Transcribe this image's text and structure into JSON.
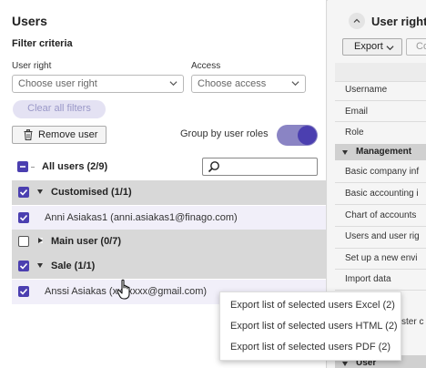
{
  "users_panel": {
    "title": "Users",
    "filter_title": "Filter criteria",
    "user_right_label": "User right",
    "user_right_placeholder": "Choose user right",
    "access_label": "Access",
    "access_placeholder": "Choose access",
    "clear_filters_label": "Clear all filters",
    "remove_user_label": "Remove user",
    "group_toggle_label": "Group by user roles",
    "group_toggle_on": true,
    "all_users_label": "All users (2/9)",
    "search_value": "",
    "rows": [
      {
        "kind": "group",
        "label": "Customised (1/1)",
        "checked": true,
        "expanded": true
      },
      {
        "kind": "user",
        "label": "Anni Asiakas1 (anni.asiakas1@finago.com)",
        "checked": true
      },
      {
        "kind": "group",
        "label": "Main user (0/7)",
        "checked": false,
        "expanded": false
      },
      {
        "kind": "group",
        "label": "Sale (1/1)",
        "checked": true,
        "expanded": true
      },
      {
        "kind": "user",
        "label": "Anssi Asiakas (xxxxxxx@gmail.com)",
        "checked": true
      }
    ]
  },
  "export_menu": {
    "items": [
      "Export list of selected users Excel (2)",
      "Export list of selected users HTML (2)",
      "Export list of selected users PDF (2)"
    ]
  },
  "rights_panel": {
    "title": "User rights",
    "export_label": "Export",
    "copy_label": "Co",
    "fields": [
      "Username",
      "Email",
      "Role"
    ],
    "section_management": "Management",
    "items": [
      "Basic company inf",
      "Basic accounting i",
      "Chart of accounts",
      "Users and user rig",
      "Set up a new envi",
      "Import data",
      "ster c"
    ],
    "section_user": "User"
  },
  "colors": {
    "accent": "#4b3fb0",
    "toggle_track": "#8a84c4",
    "group_row_bg": "#d8d8d8",
    "user_row_bg": "#f1eff9"
  }
}
